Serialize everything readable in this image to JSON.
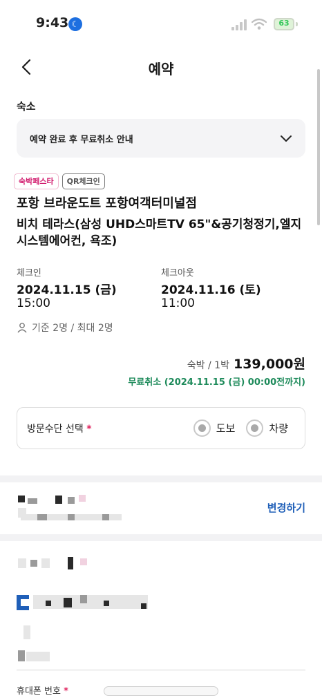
{
  "status_bar": {
    "time": "9:43",
    "battery": "63",
    "colors": {
      "moon_badge": "#1d6fe0",
      "battery_text": "#34c759"
    }
  },
  "header": {
    "title": "예약",
    "back_icon": "chevron-left-icon"
  },
  "section": {
    "label": "숙소"
  },
  "notice": {
    "text": "예약 완료 후 무료취소 안내",
    "icon": "chevron-down-icon"
  },
  "tags": [
    {
      "label": "숙박페스타"
    },
    {
      "label": "QR체크인"
    }
  ],
  "hotel": {
    "name": "포항 브라운도트 포항여객터미널점",
    "room": "비치 테라스(삼성 UHD스마트TV 65\"&공기청정기,엘지시스템에어컨, 욕조)"
  },
  "checkin": {
    "label": "체크인",
    "date": "2024.11.15 (금)",
    "time": "15:00"
  },
  "checkout": {
    "label": "체크아웃",
    "date": "2024.11.16 (토)",
    "time": "11:00"
  },
  "guests": {
    "icon": "person-icon",
    "text": "기준 2명 / 최대 2명"
  },
  "price": {
    "unit": "숙박 / 1박",
    "amount": "139,000원",
    "free_cancel": "무료취소 (2024.11.15 (금) 00:00전까지)",
    "colors": {
      "free_cancel": "#1d8a5a"
    }
  },
  "visit": {
    "label": "방문수단 선택",
    "required": "*",
    "options": [
      {
        "label": "도보"
      },
      {
        "label": "차량"
      }
    ]
  },
  "contact": {
    "change_label": "변경하기",
    "colors": {
      "change": "#1f5fb8"
    }
  },
  "phone": {
    "label": "휴대폰 번호",
    "required": "*"
  }
}
